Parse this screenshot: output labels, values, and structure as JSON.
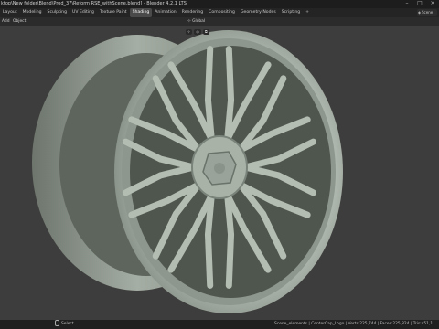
{
  "window": {
    "title": "ktop\\New folder\\Blend\\Prod_37\\Reform RSE_withScene.blend] - Blender 4.2.1 LTS",
    "controls": [
      "minimize-icon",
      "maximize-icon",
      "close-icon"
    ]
  },
  "menubar": {
    "tabs": [
      "Layout",
      "Modeling",
      "Sculpting",
      "UV Editing",
      "Texture Paint",
      "Shading",
      "Animation",
      "Rendering",
      "Compositing",
      "Geometry Nodes",
      "Scripting",
      "+"
    ],
    "active_tab": "Shading",
    "scene_label": "Scene"
  },
  "viewport_header": {
    "menus": [
      "Add",
      "Object"
    ],
    "transform_orientation": "Global"
  },
  "statusbar": {
    "select_label": "Select",
    "info": "Scene_elements | CenterCap_Logo | Verts:225,744 | Faces:225,824 | Tris:451,1..."
  },
  "colors": {
    "titlebar": "#1d1d1d",
    "menubar": "#242424",
    "viewport_bg": "#3d3d3d",
    "wheel": "#b9c2b8",
    "wheel_shadow": "#6f776e"
  }
}
